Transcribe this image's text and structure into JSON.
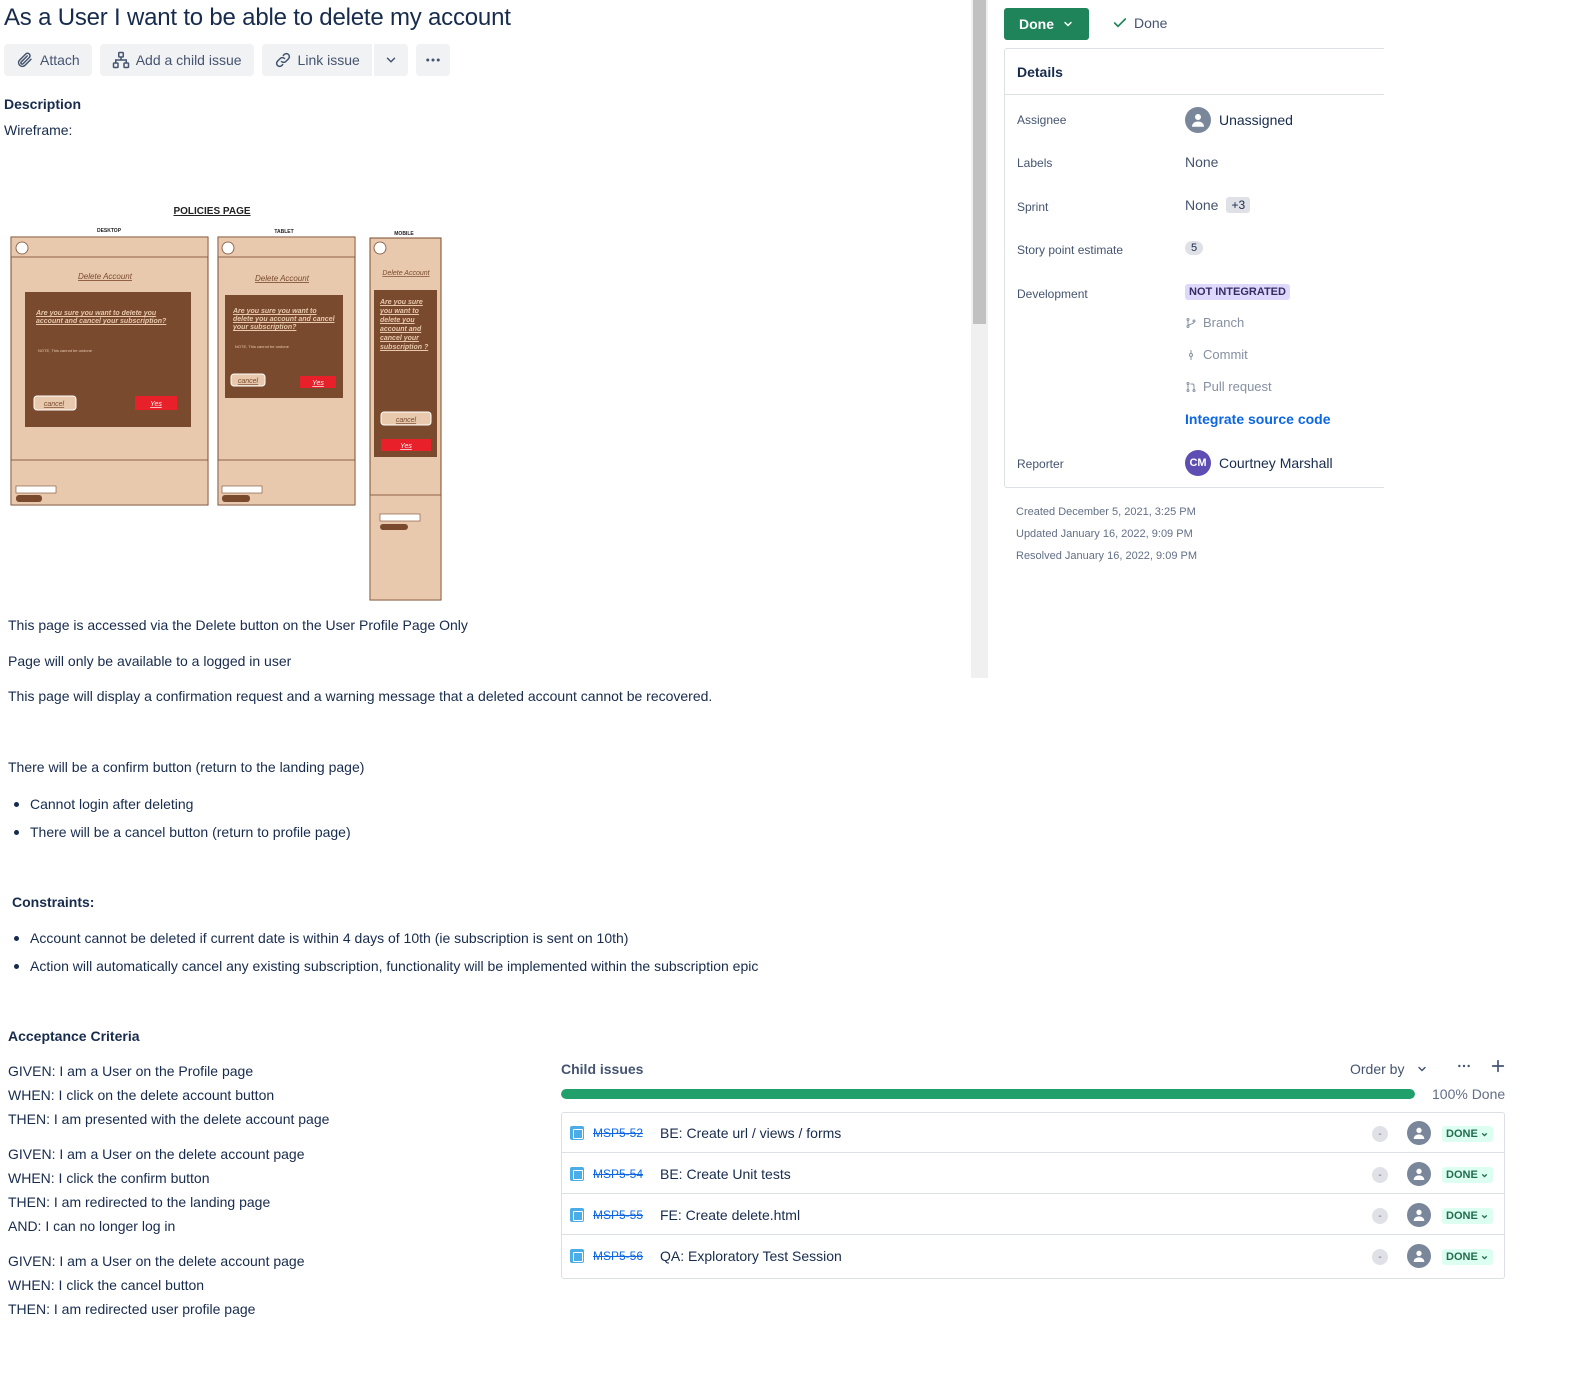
{
  "issue": {
    "title": "As a User I want to be able to delete my account"
  },
  "toolbar": {
    "attach": "Attach",
    "add_child": "Add a child issue",
    "link_issue": "Link issue"
  },
  "description": {
    "heading": "Description",
    "wireframe_label": "Wireframe:",
    "wireframe": {
      "page_title": "POLICIES PAGE",
      "desktop": "DESKTOP",
      "tablet": "TABLET",
      "mobile": "MOBILE",
      "dialog_title": "Delete Account",
      "dialog_text_desktop": "Are you sure you want to delete you account and cancel your subscription?",
      "dialog_text_tablet": "Are you sure you want to delete you account and cancel your subscription?",
      "dialog_text_mobile": "Are you sure you want to delete you account and cancel your subscription ?",
      "note": "NOTE, This cannot be undone",
      "cancel": "cancel",
      "yes": "Yes"
    },
    "p1": "This page is accessed via the Delete button on the User Profile Page Only",
    "p2": "Page will only be available to a logged in user",
    "p3": "This page will display a confirmation request and a warning message that a deleted account cannot be recovered.",
    "p4": "There will be a confirm button (return to the landing page)",
    "bullets1": [
      "Cannot login after deleting",
      "There will be a cancel button  (return to profile page)"
    ],
    "constraints_heading": "Constraints:",
    "constraints": [
      "Account cannot be deleted if current date is within 4 days of 10th (ie subscription is sent on 10th)",
      "Action will automatically cancel any existing subscription, functionality will be implemented within the subscription epic"
    ],
    "ac_heading": "Acceptance Criteria",
    "ac": [
      "GIVEN: I am a User on the Profile page",
      "WHEN: I click on the delete account button",
      "THEN: I am presented with the delete account page",
      "GIVEN: I am a User on the delete account page",
      "WHEN: I click the confirm button",
      "THEN: I am redirected to the landing page",
      "AND: I can no longer log in",
      "GIVEN: I am a User on the delete account page",
      "WHEN: I click the cancel button",
      "THEN: I am redirected user profile page"
    ]
  },
  "status": {
    "button": "Done",
    "resolution": "Done"
  },
  "details": {
    "heading": "Details",
    "assignee_label": "Assignee",
    "assignee": "Unassigned",
    "labels_label": "Labels",
    "labels": "None",
    "sprint_label": "Sprint",
    "sprint": "None",
    "sprint_extra": "+3",
    "story_points_label": "Story point estimate",
    "story_points": "5",
    "development_label": "Development",
    "development_status": "NOT INTEGRATED",
    "branch": "Branch",
    "commit": "Commit",
    "pull_request": "Pull request",
    "integrate": "Integrate source code",
    "reporter_label": "Reporter",
    "reporter": "Courtney Marshall",
    "reporter_initials": "CM"
  },
  "meta": {
    "created": "Created December 5, 2021, 3:25 PM",
    "updated": "Updated January 16, 2022, 9:09 PM",
    "resolved": "Resolved January 16, 2022, 9:09 PM"
  },
  "child_issues": {
    "heading": "Child issues",
    "order_by": "Order by",
    "progress_percent": 100,
    "progress_label": "100% Done",
    "items": [
      {
        "key": "MSP5-52",
        "summary": "BE: Create url / views / forms",
        "priority": "-",
        "status": "DONE"
      },
      {
        "key": "MSP5-54",
        "summary": "BE: Create Unit tests",
        "priority": "-",
        "status": "DONE"
      },
      {
        "key": "MSP5-55",
        "summary": "FE: Create delete.html",
        "priority": "-",
        "status": "DONE"
      },
      {
        "key": "MSP5-56",
        "summary": "QA: Exploratory Test Session",
        "priority": "-",
        "status": "DONE"
      }
    ]
  },
  "colors": {
    "done_green": "#1f845a",
    "link_blue": "#0c66e4",
    "wire_brown": "#7a4a2e",
    "wire_tan": "#e8c9ad",
    "wire_red": "#e8202a"
  }
}
